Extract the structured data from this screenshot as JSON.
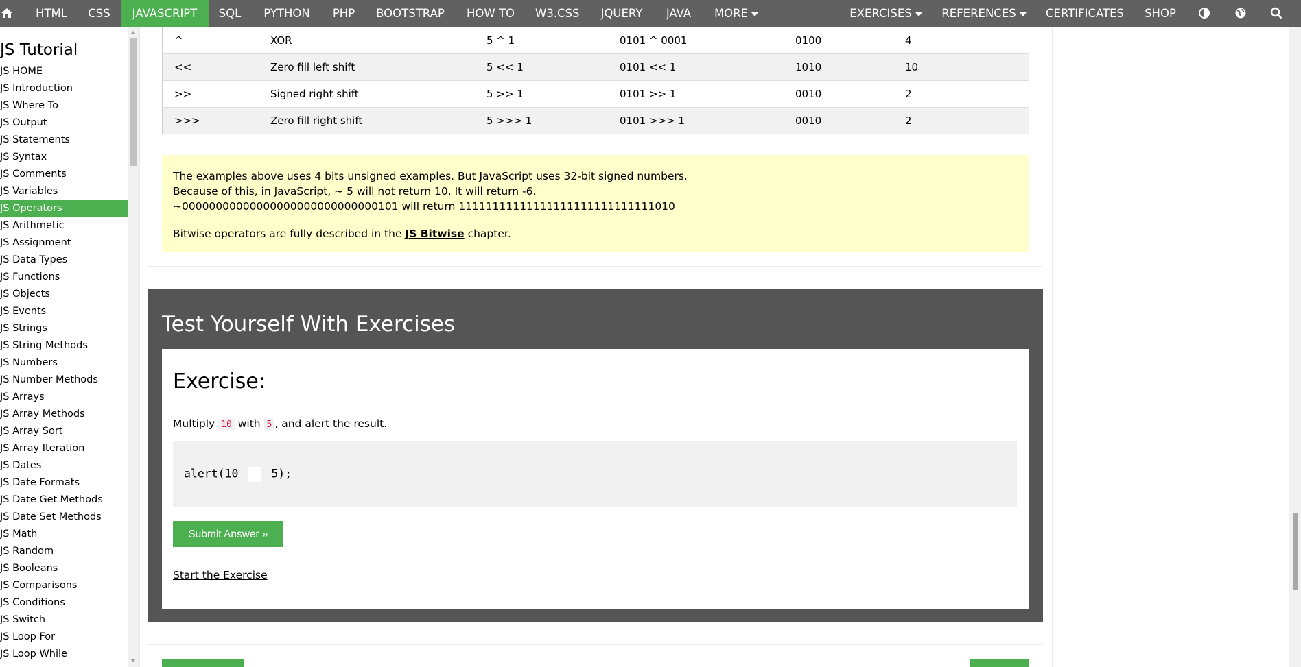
{
  "nav": {
    "items": [
      "HTML",
      "CSS",
      "JAVASCRIPT",
      "SQL",
      "PYTHON",
      "PHP",
      "BOOTSTRAP",
      "HOW TO",
      "W3.CSS",
      "JQUERY",
      "JAVA",
      "MORE"
    ],
    "right_items": [
      "EXERCISES",
      "REFERENCES",
      "CERTIFICATES",
      "SHOP"
    ],
    "active": "JAVASCRIPT",
    "colors": {
      "bar": "#616161",
      "active": "#4CAF50"
    }
  },
  "sidebar": {
    "title": "JS Tutorial",
    "links": [
      "JS HOME",
      "JS Introduction",
      "JS Where To",
      "JS Output",
      "JS Statements",
      "JS Syntax",
      "JS Comments",
      "JS Variables",
      "JS Operators",
      "JS Arithmetic",
      "JS Assignment",
      "JS Data Types",
      "JS Functions",
      "JS Objects",
      "JS Events",
      "JS Strings",
      "JS String Methods",
      "JS Numbers",
      "JS Number Methods",
      "JS Arrays",
      "JS Array Methods",
      "JS Array Sort",
      "JS Array Iteration",
      "JS Dates",
      "JS Date Formats",
      "JS Date Get Methods",
      "JS Date Set Methods",
      "JS Math",
      "JS Random",
      "JS Booleans",
      "JS Comparisons",
      "JS Conditions",
      "JS Switch",
      "JS Loop For",
      "JS Loop While"
    ],
    "active": "JS Operators"
  },
  "table": {
    "rows": [
      [
        "^",
        "XOR",
        "5 ^ 1",
        "0101 ^ 0001",
        "0100",
        "4"
      ],
      [
        "<<",
        "Zero fill left shift",
        "5 << 1",
        "0101 << 1",
        "1010",
        "10"
      ],
      [
        ">>",
        "Signed right shift",
        "5 >> 1",
        "0101 >> 1",
        "0010",
        "2"
      ],
      [
        ">>>",
        "Zero fill right shift",
        "5 >>> 1",
        "0101 >>> 1",
        "0010",
        "2"
      ]
    ]
  },
  "note": {
    "line1": "The examples above uses 4 bits unsigned examples. But JavaScript uses 32-bit signed numbers.",
    "line2": "Because of this, in JavaScript, ~ 5 will not return 10. It will return -6.",
    "line3": "~00000000000000000000000000000101 will return 11111111111111111111111111111010",
    "bitwise_prefix": "Bitwise operators are fully described in the ",
    "bitwise_link": "JS Bitwise",
    "bitwise_suffix": " chapter."
  },
  "exercise": {
    "heading": "Test Yourself With Exercises",
    "title": "Exercise:",
    "desc_prefix": "Multiply ",
    "num1": "10",
    "desc_mid": " with ",
    "num2": "5",
    "desc_suffix": ", and alert the result.",
    "code_before": "alert(10 ",
    "code_after": " 5);",
    "submit_label": "Submit Answer »",
    "start_link": "Start the Exercise"
  }
}
